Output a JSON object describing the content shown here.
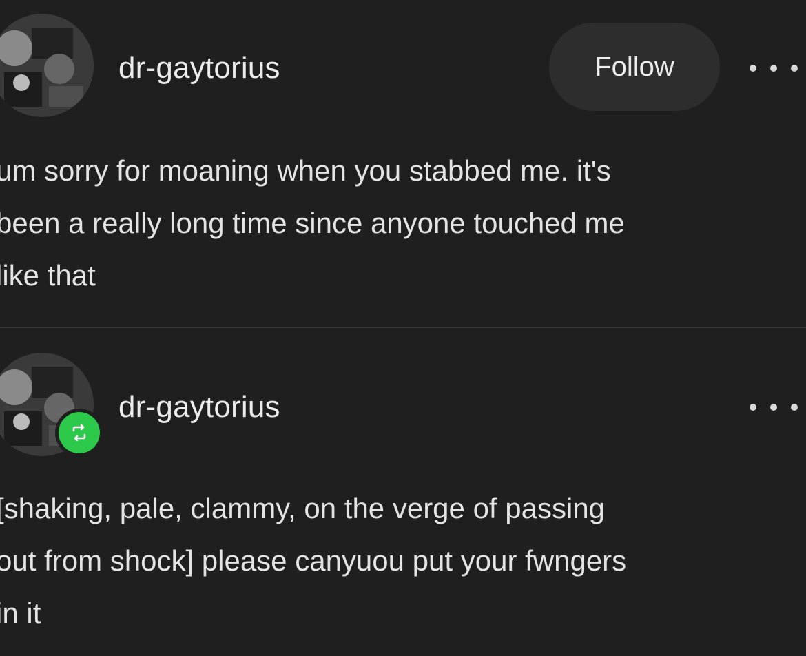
{
  "posts": [
    {
      "username": "dr-gaytorius",
      "follow_label": "Follow",
      "text": "um sorry for moaning when you stabbed me. it's\nbeen a really long time since anyone touched me\nlike that"
    },
    {
      "username": "dr-gaytorius",
      "reblog_icon": "reblog-icon",
      "text": "[shaking, pale, clammy, on the verge of passing\nout from shock] please canyuou put your fwngers\nin it"
    }
  ],
  "colors": {
    "background": "#1f1f20",
    "follow_button": "#2d2d2e",
    "reblog_badge": "#2cc94a"
  }
}
